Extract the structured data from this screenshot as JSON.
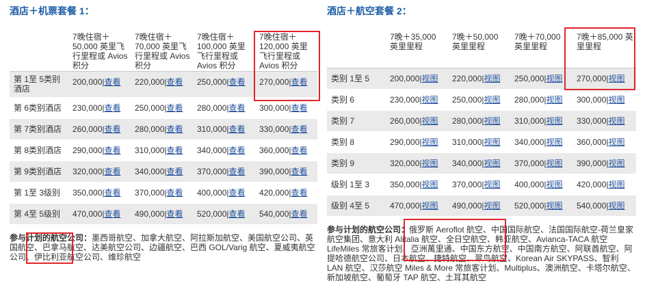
{
  "panel1": {
    "title": "酒店＋机票套餐 1：",
    "headers": [
      "",
      "7晚住宿＋50,000 英里飞行里程或 Avios 积分",
      "7晚住宿＋70,000 英里飞行里程或 Avios 积分",
      "7晚住宿＋100,000 英里飞行里程或 Avios 积分",
      "7晚住宿＋120,000 英里飞行里程或 Avios 积分"
    ],
    "link_label": "查看",
    "rows": [
      {
        "label": "第 1至 5类别酒店",
        "values": [
          "200,000",
          "220,000",
          "250,000",
          "270,000"
        ]
      },
      {
        "label": "第 6类别酒店",
        "values": [
          "230,000",
          "250,000",
          "280,000",
          "300,000"
        ]
      },
      {
        "label": "第 7类别酒店",
        "values": [
          "260,000",
          "280,000",
          "310,000",
          "330,000"
        ]
      },
      {
        "label": "第 8类别酒店",
        "values": [
          "290,000",
          "310,000",
          "340,000",
          "360,000"
        ]
      },
      {
        "label": "第 9类别酒店",
        "values": [
          "320,000",
          "340,000",
          "370,000",
          "390,000"
        ]
      },
      {
        "label": "第 1至 3级别",
        "values": [
          "350,000",
          "370,000",
          "400,000",
          "420,000"
        ]
      },
      {
        "label": "第 4至 5级别",
        "values": [
          "470,000",
          "490,000",
          "520,000",
          "540,000"
        ]
      }
    ],
    "partners_label": "参与计划的航空公司：",
    "partners_text": "墨西哥航空、加拿大航空、阿拉斯加航空、美国航空公司、英国航空、巴拿马航空、达美航空公司、边疆航空、巴西 GOL/Varig 航空、夏威夷航空公司、伊比利亚航空公司、维珍航空"
  },
  "panel2": {
    "title": "酒店＋航空套餐 2：",
    "headers": [
      "",
      "7晚＋35,000 英里里程",
      "7晚＋50,000 英里里程",
      "7晚＋70,000 英里里程",
      "7晚＋85,000 英里里程"
    ],
    "link_label": "视图",
    "rows": [
      {
        "label": "类别 1至 5",
        "values": [
          "200,000",
          "220,000",
          "250,000",
          "270,000"
        ]
      },
      {
        "label": "类别 6",
        "values": [
          "230,000",
          "250,000",
          "280,000",
          "300,000"
        ]
      },
      {
        "label": "类别 7",
        "values": [
          "260,000",
          "280,000",
          "310,000",
          "330,000"
        ]
      },
      {
        "label": "类别 8",
        "values": [
          "290,000",
          "310,000",
          "340,000",
          "360,000"
        ]
      },
      {
        "label": "类别 9",
        "values": [
          "320,000",
          "340,000",
          "370,000",
          "390,000"
        ]
      },
      {
        "label": "级别 1至 3",
        "values": [
          "350,000",
          "370,000",
          "400,000",
          "420,000"
        ]
      },
      {
        "label": "级别 4至 5",
        "values": [
          "470,000",
          "490,000",
          "520,000",
          "540,000"
        ]
      }
    ],
    "partners_label": "参与计划的航空公司：",
    "partners_text": "俄罗斯 Aeroflot 航空、中国国际航空、法国国际航空-荷兰皇家航空集团、意大利 Alitalia 航空、全日空航空、韩亚航空、Avianca-TACA 航空 LifeMiles 常旅客计划、亞洲萬里通、中国东方航空、中国南方航空、阿联酋航空、阿提哈德航空公司、日本航空、捷特航空、翠鸟航空、Korean Air SKYPASS、智利 LAN 航空、汉莎航空 Miles & More 常旅客计划、Multiplus、澳洲航空、卡塔尔航空、新加坡航空、葡萄牙 TAP 航空、土耳其航空"
  },
  "colors": {
    "title": "#1f5fa8",
    "link": "#1f4f9c",
    "highlight": "#e0252b",
    "row_shade": "#eaeaea"
  }
}
